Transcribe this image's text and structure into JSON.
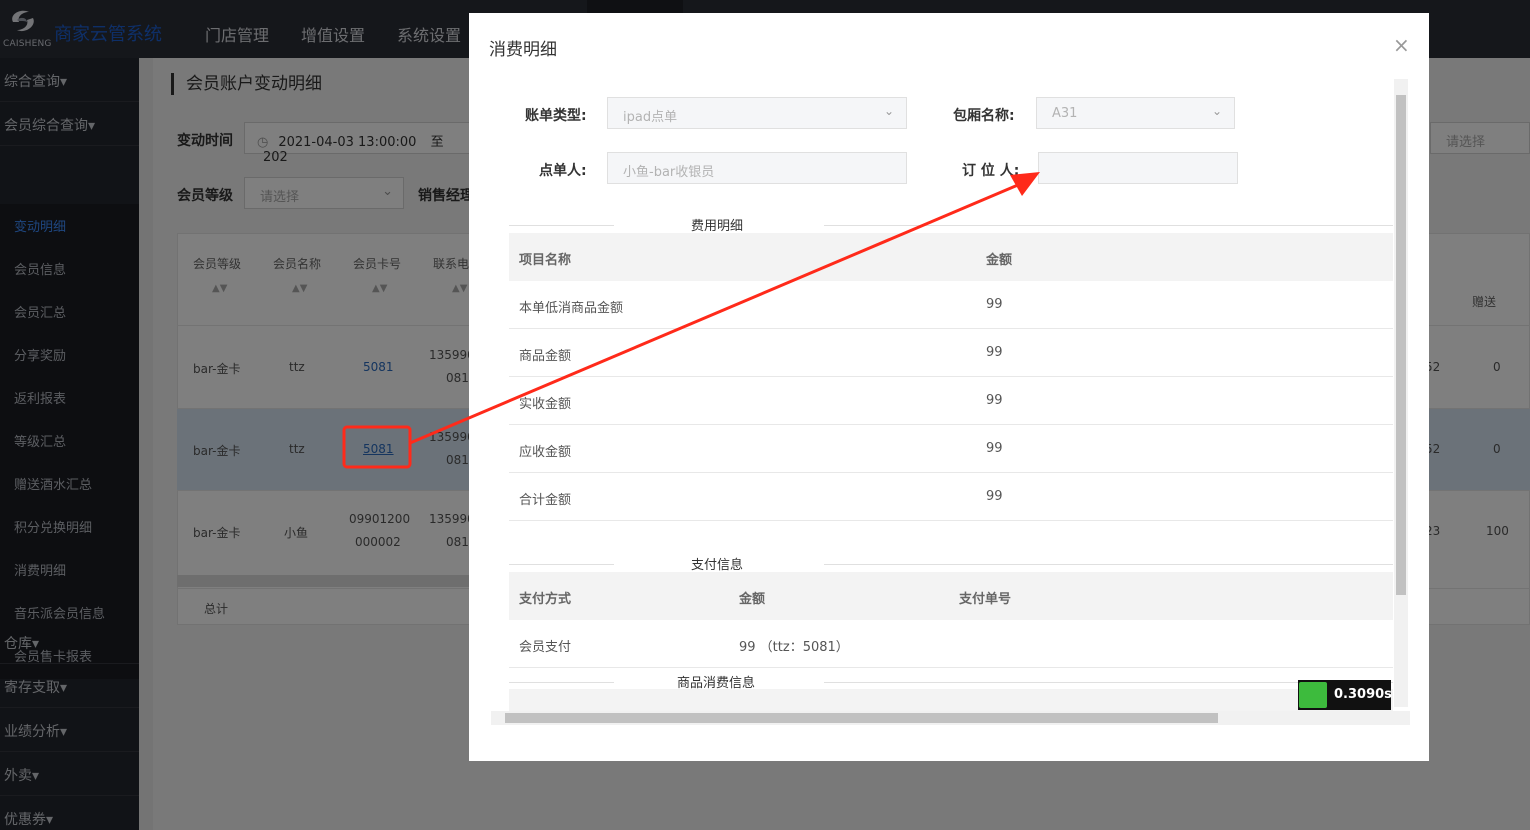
{
  "app": {
    "logo_text": "CAISHENG",
    "title": "商家云管系统",
    "top_nav": [
      "门店管理",
      "增值设置",
      "系统设置"
    ]
  },
  "sidebar": {
    "groups_top": [
      "综合查询▾",
      "会员综合查询▾"
    ],
    "sub_items": [
      "变动明细",
      "会员信息",
      "会员汇总",
      "分享奖励",
      "返利报表",
      "等级汇总",
      "赠送酒水汇总",
      "积分兑换明细",
      "消费明细",
      "音乐派会员信息",
      "会员售卡报表"
    ],
    "active_item": "变动明细",
    "groups_bottom": [
      "仓库▾",
      "寄存支取▾",
      "业绩分析▾",
      "外卖▾",
      "优惠券▾"
    ]
  },
  "page": {
    "title": "会员账户变动明细",
    "filters": {
      "change_time_label": "变动时间",
      "change_time_value": "2021-04-03 13:00:00",
      "to_label": "至",
      "to_value_partial": "202",
      "member_level_label": "会员等级",
      "member_level_placeholder": "请选择",
      "sales_manager_label": "销售经理",
      "right_placeholder": "请选择"
    },
    "table": {
      "headers": [
        "会员等级",
        "会员名称",
        "会员卡号",
        "联系电"
      ],
      "right_header": "赠送",
      "sort_glyph": "▲▼",
      "rows": [
        {
          "level": "bar-金卡",
          "name": "ttz",
          "card": "5081",
          "phone_1": "135990",
          "phone_2": "081",
          "right_partial": "52",
          "gift": "0"
        },
        {
          "level": "bar-金卡",
          "name": "ttz",
          "card": "5081",
          "phone_1": "135990",
          "phone_2": "081",
          "right_partial": "52",
          "gift": "0"
        },
        {
          "level": "bar-金卡",
          "name": "小鱼",
          "card_1": "09901200",
          "card_2": "000002",
          "phone_1": "135990",
          "phone_2": "081",
          "right_partial": "23",
          "gift": "100"
        }
      ],
      "total_label": "总计"
    }
  },
  "modal": {
    "title": "消费明细",
    "close_glyph": "×",
    "bill_type_label": "账单类型:",
    "bill_type_value": "ipad点单",
    "room_label": "包厢名称:",
    "room_value": "A31",
    "orderer_label": "点单人:",
    "orderer_value": "小鱼-bar收银员",
    "reserver_label": "订 位 人:",
    "reserver_value": "",
    "fee_section": "费用明细",
    "fee_headers": [
      "项目名称",
      "金额"
    ],
    "fee_rows": [
      {
        "name": "本单低消商品金额",
        "amount": "99"
      },
      {
        "name": "商品金额",
        "amount": "99"
      },
      {
        "name": "实收金额",
        "amount": "99"
      },
      {
        "name": "应收金额",
        "amount": "99"
      },
      {
        "name": "合计金额",
        "amount": "99"
      }
    ],
    "pay_section": "支付信息",
    "pay_headers": [
      "支付方式",
      "金额",
      "支付单号"
    ],
    "pay_rows": [
      {
        "method": "会员支付",
        "amount": "99 （ttz：5081）",
        "order_no": ""
      }
    ],
    "goods_section": "商品消费信息"
  },
  "timer": {
    "value": "0.3090s"
  },
  "colors": {
    "accent": "#3d8cff",
    "annotation": "#ff2a1a",
    "sidebar_bg": "#23262e"
  }
}
